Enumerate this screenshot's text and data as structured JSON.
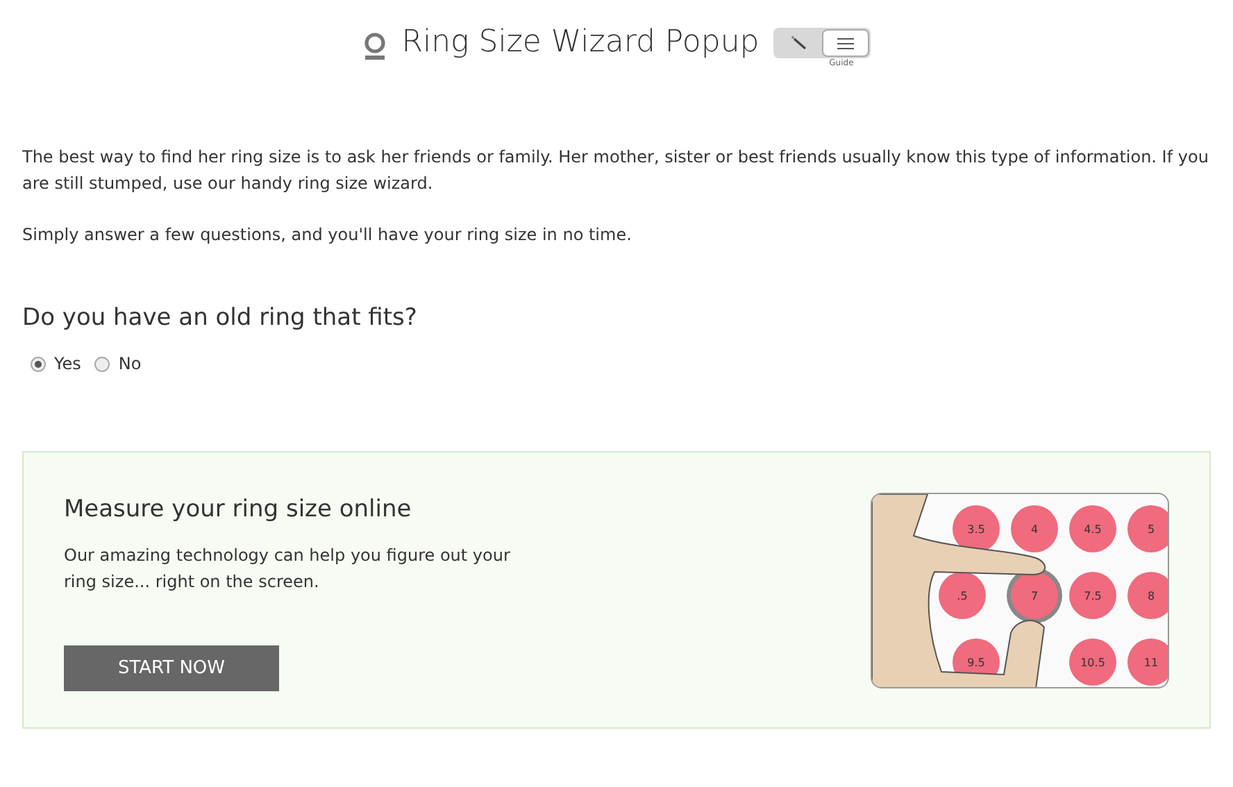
{
  "header": {
    "title": "Ring Size Wizard Popup",
    "view_toggle": [
      {
        "kind": "wand",
        "selected": false
      },
      {
        "kind": "list",
        "selected": true
      }
    ],
    "toggle_caption": "Guide"
  },
  "intro": [
    "The best way to find her ring size is to ask her friends or family. Her mother, sister or best friends usually know this type of information. If you are still stumped, use our handy ring size wizard.",
    "Simply answer a few questions, and you'll have your ring size in no time."
  ],
  "question": {
    "text": "Do you have an old ring that fits?",
    "options": [
      {
        "label": "Yes",
        "selected": true
      },
      {
        "label": "No",
        "selected": false
      }
    ]
  },
  "card": {
    "heading": "Measure your ring size online",
    "body": "Our amazing technology can help you figure out your ring size... right on the screen.",
    "button": "START NOW",
    "size_dots": [
      "3.5",
      "4",
      "4.5",
      "5",
      ".5",
      "7",
      "7.5",
      "8",
      "9.5",
      "10.5",
      "11"
    ]
  }
}
